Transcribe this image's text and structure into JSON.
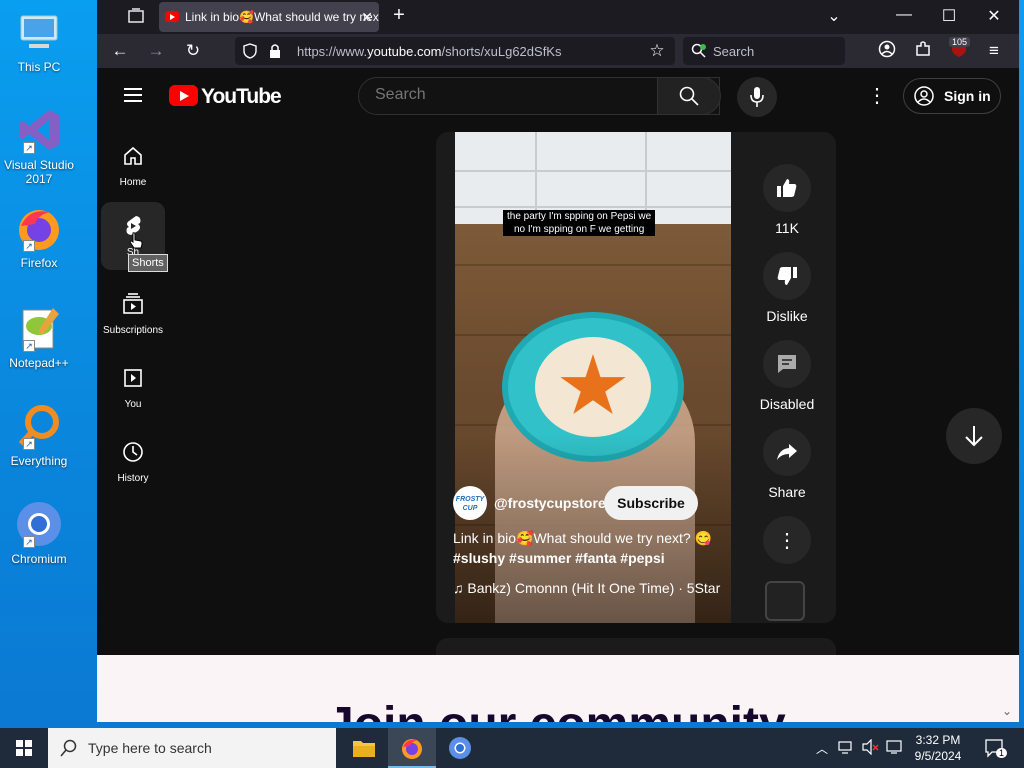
{
  "desktop": {
    "icons": [
      {
        "label": "This PC"
      },
      {
        "label": "Visual Studio 2017"
      },
      {
        "label": "Firefox"
      },
      {
        "label": "Notepad++"
      },
      {
        "label": "Everything"
      },
      {
        "label": "Chromium"
      }
    ]
  },
  "browser": {
    "tab_title": "Link in bio🥰What should we try next?",
    "url_prefix": "https://www.",
    "url_domain": "youtube.com",
    "url_path": "/shorts/xuLg62dSfKs",
    "search_label": "Search",
    "extension_badge": "105"
  },
  "youtube": {
    "logo_text": "YouTube",
    "search_placeholder": "Search",
    "signin_label": "Sign in",
    "sidebar": [
      {
        "label": "Home"
      },
      {
        "label": "Sh"
      },
      {
        "label": "Subscriptions"
      },
      {
        "label": "You"
      },
      {
        "label": "History"
      }
    ],
    "tooltip": "Shorts",
    "short": {
      "caption_line1": "the party I'm spping on Pepsi we",
      "caption_line2": "no I'm spping on F we getting",
      "channel_avatar_text": "FROSTY CUP",
      "channel": "@frostycupstore",
      "subscribe_label": "Subscribe",
      "title": "Link in bio🥰What should we try next? 😋",
      "hashtags": "#slushy #summer #fanta #pepsi",
      "music": "♫  Bankz)     Cmonnn (Hit It One Time) · 5Star",
      "like_count": "11K",
      "dislike_label": "Dislike",
      "comments_label": "Disabled",
      "share_label": "Share"
    },
    "footer_text": "Join our community"
  },
  "taskbar": {
    "search_placeholder": "Type here to search",
    "time": "3:32 PM",
    "date": "9/5/2024",
    "notification_count": "1"
  },
  "colors": {
    "youtube_red": "#ff0000",
    "page_bg": "#0f0f0f",
    "desktop_blue": "#0a9ef0"
  }
}
